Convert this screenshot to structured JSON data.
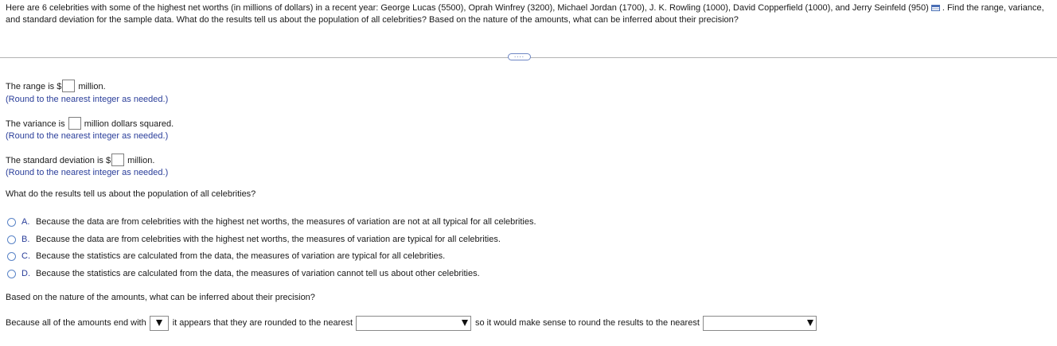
{
  "question": {
    "text_before_icon": "Here are 6 celebrities with some of the highest net worths (in millions of dollars) in a recent year: George Lucas (5500), Oprah Winfrey (3200), Michael Jordan (1700), J. K. Rowling (1000), David Copperfield (1000), and Jerry Seinfeld (950)",
    "data_icon": "data-table-icon",
    "text_after_icon": ". Find the range, variance, and standard deviation for the sample data. What do the results tell us about the population of all celebrities? Based on the nature of the amounts, what can be inferred about their precision?"
  },
  "expand_button": {
    "label": "....",
    "icon": "more-dots-icon"
  },
  "range": {
    "prefix": "The range is $",
    "suffix": "million.",
    "hint": "(Round to the nearest integer as needed.)"
  },
  "variance": {
    "prefix": "The variance is",
    "suffix": "million dollars squared.",
    "hint": "(Round to the nearest integer as needed.)"
  },
  "stddev": {
    "prefix": "The standard deviation is $",
    "suffix": "million.",
    "hint": "(Round to the nearest integer as needed.)"
  },
  "population_question": "What do the results tell us about the population of all celebrities?",
  "options": [
    {
      "letter": "A.",
      "text": "Because the data are from celebrities with the highest net worths, the measures of variation are not at all typical for all celebrities."
    },
    {
      "letter": "B.",
      "text": "Because the data are from celebrities with the highest net worths, the measures of variation are typical for all celebrities."
    },
    {
      "letter": "C.",
      "text": "Because the statistics are calculated from the data, the measures of variation are typical for all celebrities."
    },
    {
      "letter": "D.",
      "text": "Because the statistics are calculated from the data, the measures of variation cannot tell us about other celebrities."
    }
  ],
  "precision_question": "Based on the nature of the amounts, what can be inferred about their precision?",
  "final": {
    "part1": "Because all of the amounts end with",
    "part2": "it appears that they are rounded to the nearest",
    "part3": "so it would make sense to round the results to the nearest"
  },
  "colors": {
    "hint_text": "#2a3e9a",
    "radio_border": "#5a84c7",
    "divider": "#b3b3b3"
  }
}
